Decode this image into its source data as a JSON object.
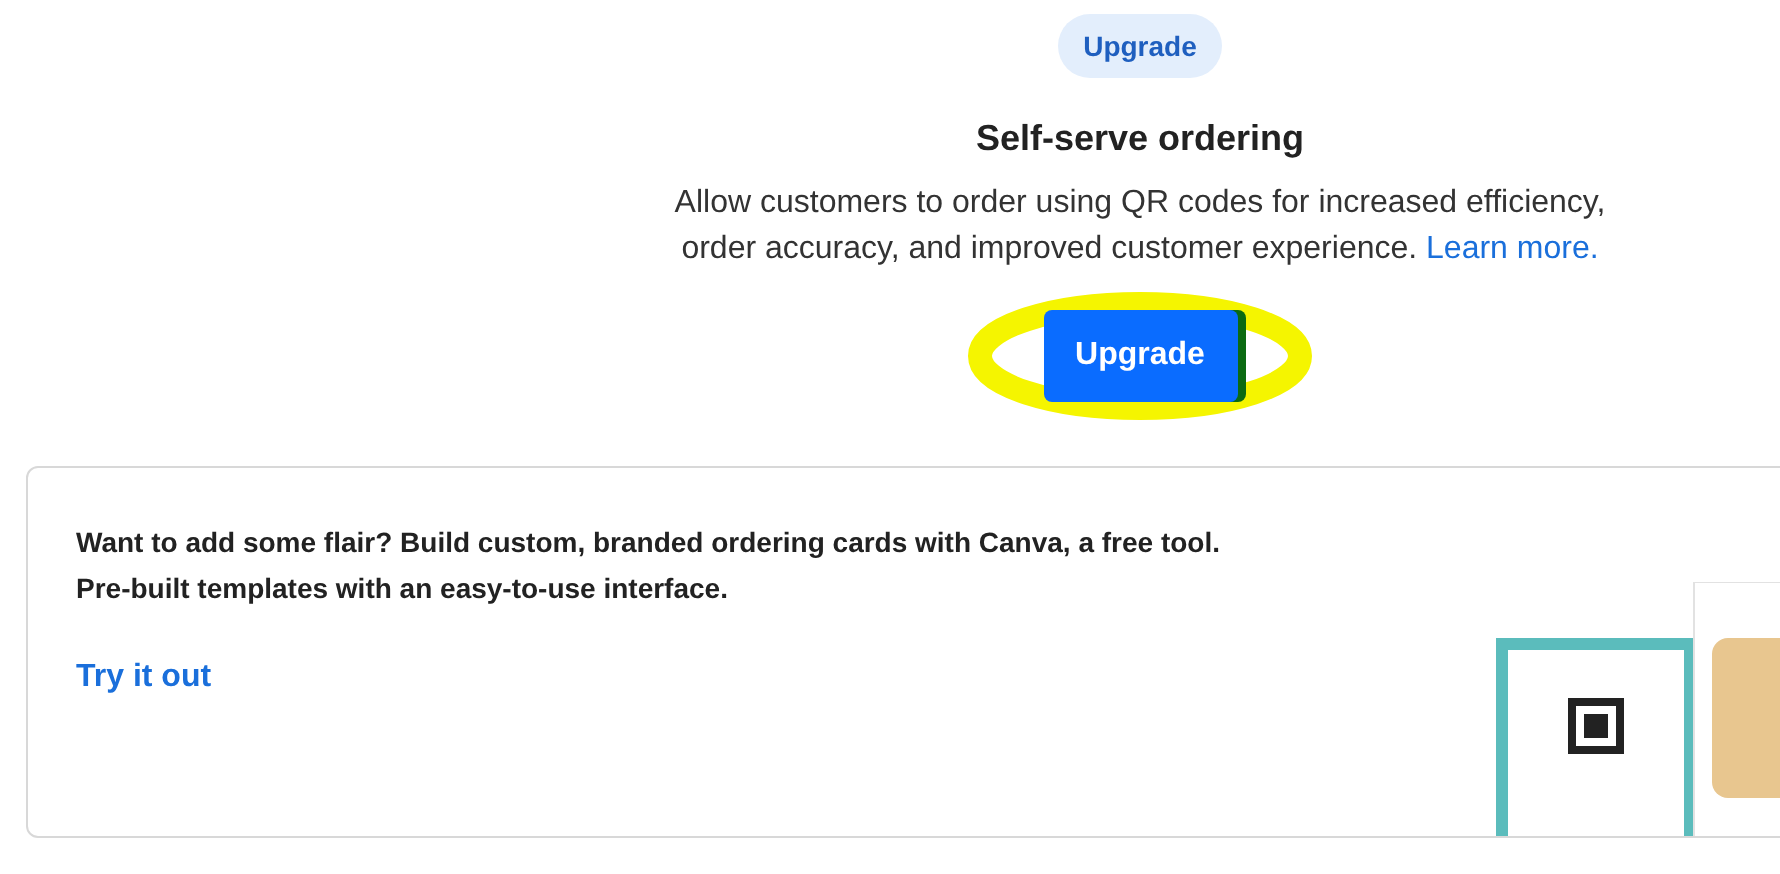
{
  "plan_badge": "Upgrade",
  "feature": {
    "title": "Self-serve ordering",
    "description": "Allow customers to order using QR codes for increased efficiency, order accuracy, and improved customer experience.",
    "link": "Learn more.",
    "button": "Upgrade",
    "highlighted": true
  },
  "promo": {
    "text": "Want to add some flair? Build custom, branded ordering cards with Canva, a free tool. Pre-built templates with an easy-to-use interface.",
    "link": "Try it out"
  }
}
